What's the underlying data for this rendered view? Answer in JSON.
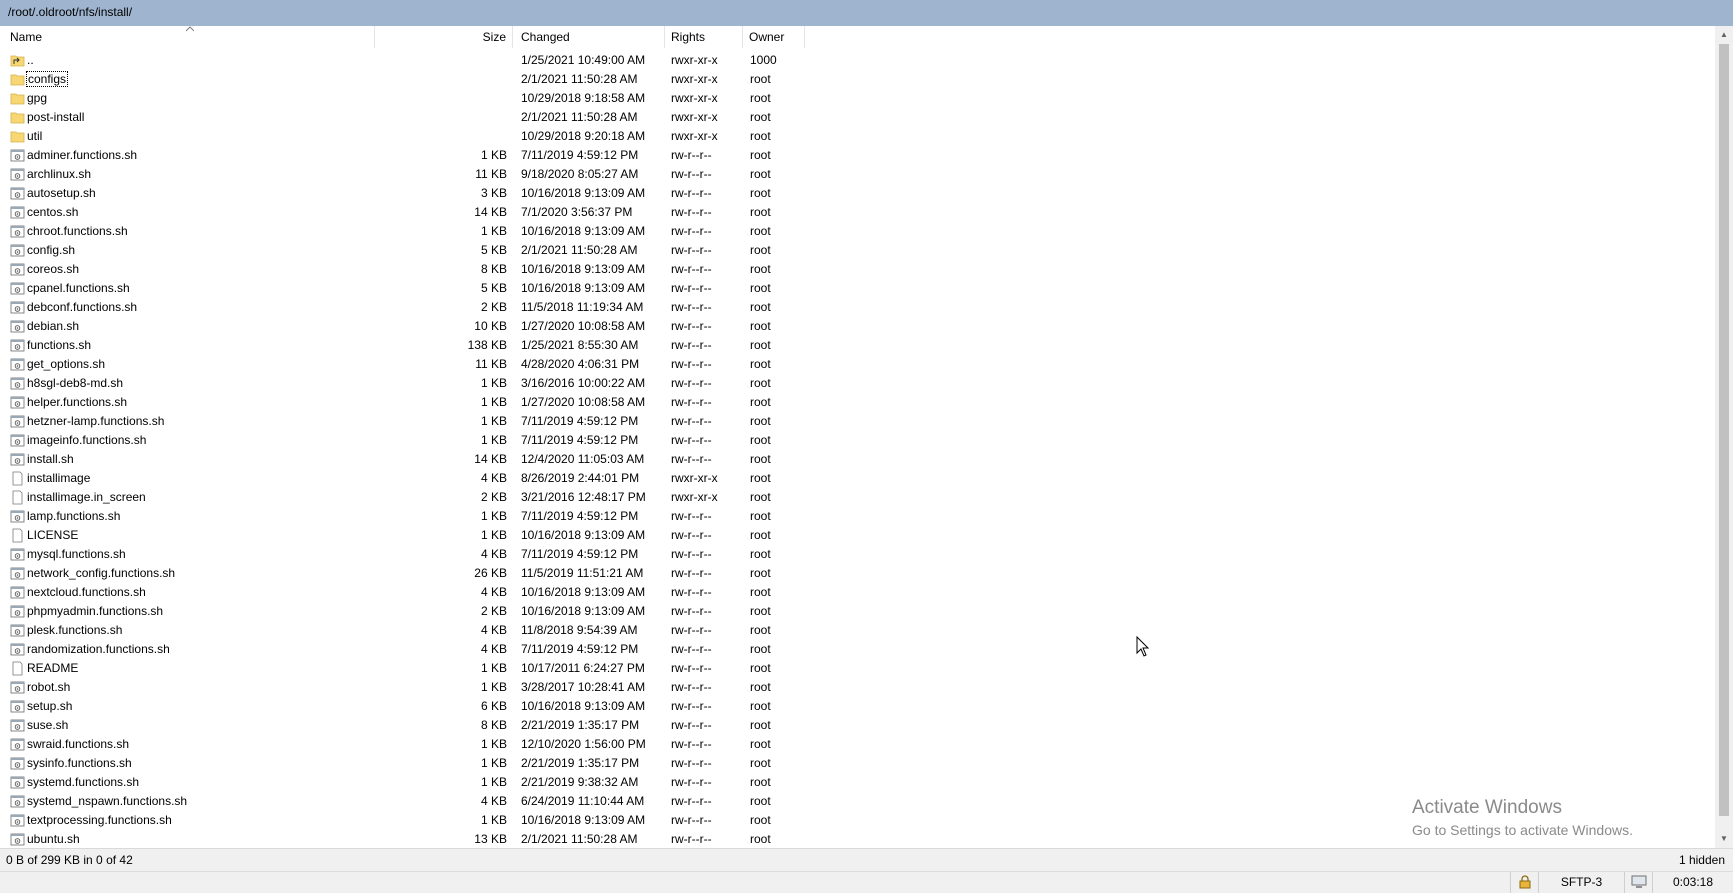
{
  "path": "/root/.oldroot/nfs/install/",
  "columns": {
    "name": "Name",
    "size": "Size",
    "changed": "Changed",
    "rights": "Rights",
    "owner": "Owner"
  },
  "files": [
    {
      "name": "..",
      "size": "",
      "changed": "1/25/2021 10:49:00 AM",
      "rights": "rwxr-xr-x",
      "owner": "1000",
      "icon": "parent-folder-icon"
    },
    {
      "name": "configs",
      "size": "",
      "changed": "2/1/2021 11:50:28 AM",
      "rights": "rwxr-xr-x",
      "owner": "root",
      "icon": "folder-icon"
    },
    {
      "name": "gpg",
      "size": "",
      "changed": "10/29/2018 9:18:58 AM",
      "rights": "rwxr-xr-x",
      "owner": "root",
      "icon": "folder-icon"
    },
    {
      "name": "post-install",
      "size": "",
      "changed": "2/1/2021 11:50:28 AM",
      "rights": "rwxr-xr-x",
      "owner": "root",
      "icon": "folder-icon"
    },
    {
      "name": "util",
      "size": "",
      "changed": "10/29/2018 9:20:18 AM",
      "rights": "rwxr-xr-x",
      "owner": "root",
      "icon": "folder-icon"
    },
    {
      "name": "adminer.functions.sh",
      "size": "1 KB",
      "changed": "7/11/2019 4:59:12 PM",
      "rights": "rw-r--r--",
      "owner": "root",
      "icon": "script-file-icon"
    },
    {
      "name": "archlinux.sh",
      "size": "11 KB",
      "changed": "9/18/2020 8:05:27 AM",
      "rights": "rw-r--r--",
      "owner": "root",
      "icon": "script-file-icon"
    },
    {
      "name": "autosetup.sh",
      "size": "3 KB",
      "changed": "10/16/2018 9:13:09 AM",
      "rights": "rw-r--r--",
      "owner": "root",
      "icon": "script-file-icon"
    },
    {
      "name": "centos.sh",
      "size": "14 KB",
      "changed": "7/1/2020 3:56:37 PM",
      "rights": "rw-r--r--",
      "owner": "root",
      "icon": "script-file-icon"
    },
    {
      "name": "chroot.functions.sh",
      "size": "1 KB",
      "changed": "10/16/2018 9:13:09 AM",
      "rights": "rw-r--r--",
      "owner": "root",
      "icon": "script-file-icon"
    },
    {
      "name": "config.sh",
      "size": "5 KB",
      "changed": "2/1/2021 11:50:28 AM",
      "rights": "rw-r--r--",
      "owner": "root",
      "icon": "script-file-icon"
    },
    {
      "name": "coreos.sh",
      "size": "8 KB",
      "changed": "10/16/2018 9:13:09 AM",
      "rights": "rw-r--r--",
      "owner": "root",
      "icon": "script-file-icon"
    },
    {
      "name": "cpanel.functions.sh",
      "size": "5 KB",
      "changed": "10/16/2018 9:13:09 AM",
      "rights": "rw-r--r--",
      "owner": "root",
      "icon": "script-file-icon"
    },
    {
      "name": "debconf.functions.sh",
      "size": "2 KB",
      "changed": "11/5/2018 11:19:34 AM",
      "rights": "rw-r--r--",
      "owner": "root",
      "icon": "script-file-icon"
    },
    {
      "name": "debian.sh",
      "size": "10 KB",
      "changed": "1/27/2020 10:08:58 AM",
      "rights": "rw-r--r--",
      "owner": "root",
      "icon": "script-file-icon"
    },
    {
      "name": "functions.sh",
      "size": "138 KB",
      "changed": "1/25/2021 8:55:30 AM",
      "rights": "rw-r--r--",
      "owner": "root",
      "icon": "script-file-icon"
    },
    {
      "name": "get_options.sh",
      "size": "11 KB",
      "changed": "4/28/2020 4:06:31 PM",
      "rights": "rw-r--r--",
      "owner": "root",
      "icon": "script-file-icon"
    },
    {
      "name": "h8sgl-deb8-md.sh",
      "size": "1 KB",
      "changed": "3/16/2016 10:00:22 AM",
      "rights": "rw-r--r--",
      "owner": "root",
      "icon": "script-file-icon"
    },
    {
      "name": "helper.functions.sh",
      "size": "1 KB",
      "changed": "1/27/2020 10:08:58 AM",
      "rights": "rw-r--r--",
      "owner": "root",
      "icon": "script-file-icon"
    },
    {
      "name": "hetzner-lamp.functions.sh",
      "size": "1 KB",
      "changed": "7/11/2019 4:59:12 PM",
      "rights": "rw-r--r--",
      "owner": "root",
      "icon": "script-file-icon"
    },
    {
      "name": "imageinfo.functions.sh",
      "size": "1 KB",
      "changed": "7/11/2019 4:59:12 PM",
      "rights": "rw-r--r--",
      "owner": "root",
      "icon": "script-file-icon"
    },
    {
      "name": "install.sh",
      "size": "14 KB",
      "changed": "12/4/2020 11:05:03 AM",
      "rights": "rw-r--r--",
      "owner": "root",
      "icon": "script-file-icon"
    },
    {
      "name": "installimage",
      "size": "4 KB",
      "changed": "8/26/2019 2:44:01 PM",
      "rights": "rwxr-xr-x",
      "owner": "root",
      "icon": "plain-file-icon"
    },
    {
      "name": "installimage.in_screen",
      "size": "2 KB",
      "changed": "3/21/2016 12:48:17 PM",
      "rights": "rwxr-xr-x",
      "owner": "root",
      "icon": "plain-file-icon"
    },
    {
      "name": "lamp.functions.sh",
      "size": "1 KB",
      "changed": "7/11/2019 4:59:12 PM",
      "rights": "rw-r--r--",
      "owner": "root",
      "icon": "script-file-icon"
    },
    {
      "name": "LICENSE",
      "size": "1 KB",
      "changed": "10/16/2018 9:13:09 AM",
      "rights": "rw-r--r--",
      "owner": "root",
      "icon": "plain-file-icon"
    },
    {
      "name": "mysql.functions.sh",
      "size": "4 KB",
      "changed": "7/11/2019 4:59:12 PM",
      "rights": "rw-r--r--",
      "owner": "root",
      "icon": "script-file-icon"
    },
    {
      "name": "network_config.functions.sh",
      "size": "26 KB",
      "changed": "11/5/2019 11:51:21 AM",
      "rights": "rw-r--r--",
      "owner": "root",
      "icon": "script-file-icon"
    },
    {
      "name": "nextcloud.functions.sh",
      "size": "4 KB",
      "changed": "10/16/2018 9:13:09 AM",
      "rights": "rw-r--r--",
      "owner": "root",
      "icon": "script-file-icon"
    },
    {
      "name": "phpmyadmin.functions.sh",
      "size": "2 KB",
      "changed": "10/16/2018 9:13:09 AM",
      "rights": "rw-r--r--",
      "owner": "root",
      "icon": "script-file-icon"
    },
    {
      "name": "plesk.functions.sh",
      "size": "4 KB",
      "changed": "11/8/2018 9:54:39 AM",
      "rights": "rw-r--r--",
      "owner": "root",
      "icon": "script-file-icon"
    },
    {
      "name": "randomization.functions.sh",
      "size": "4 KB",
      "changed": "7/11/2019 4:59:12 PM",
      "rights": "rw-r--r--",
      "owner": "root",
      "icon": "script-file-icon"
    },
    {
      "name": "README",
      "size": "1 KB",
      "changed": "10/17/2011 6:24:27 PM",
      "rights": "rw-r--r--",
      "owner": "root",
      "icon": "plain-file-icon"
    },
    {
      "name": "robot.sh",
      "size": "1 KB",
      "changed": "3/28/2017 10:28:41 AM",
      "rights": "rw-r--r--",
      "owner": "root",
      "icon": "script-file-icon"
    },
    {
      "name": "setup.sh",
      "size": "6 KB",
      "changed": "10/16/2018 9:13:09 AM",
      "rights": "rw-r--r--",
      "owner": "root",
      "icon": "script-file-icon"
    },
    {
      "name": "suse.sh",
      "size": "8 KB",
      "changed": "2/21/2019 1:35:17 PM",
      "rights": "rw-r--r--",
      "owner": "root",
      "icon": "script-file-icon"
    },
    {
      "name": "swraid.functions.sh",
      "size": "1 KB",
      "changed": "12/10/2020 1:56:00 PM",
      "rights": "rw-r--r--",
      "owner": "root",
      "icon": "script-file-icon"
    },
    {
      "name": "sysinfo.functions.sh",
      "size": "1 KB",
      "changed": "2/21/2019 1:35:17 PM",
      "rights": "rw-r--r--",
      "owner": "root",
      "icon": "script-file-icon"
    },
    {
      "name": "systemd.functions.sh",
      "size": "1 KB",
      "changed": "2/21/2019 9:38:32 AM",
      "rights": "rw-r--r--",
      "owner": "root",
      "icon": "script-file-icon"
    },
    {
      "name": "systemd_nspawn.functions.sh",
      "size": "4 KB",
      "changed": "6/24/2019 11:10:44 AM",
      "rights": "rw-r--r--",
      "owner": "root",
      "icon": "script-file-icon"
    },
    {
      "name": "textprocessing.functions.sh",
      "size": "1 KB",
      "changed": "10/16/2018 9:13:09 AM",
      "rights": "rw-r--r--",
      "owner": "root",
      "icon": "script-file-icon"
    },
    {
      "name": "ubuntu.sh",
      "size": "13 KB",
      "changed": "2/1/2021 11:50:28 AM",
      "rights": "rw-r--r--",
      "owner": "root",
      "icon": "script-file-icon"
    }
  ],
  "focused_row": 1,
  "status": {
    "selection": "0 B of 299 KB in 0 of 42",
    "hidden": "1 hidden"
  },
  "bottom": {
    "protocol": "SFTP-3",
    "elapsed": "0:03:18"
  },
  "watermark": {
    "line1": "Activate Windows",
    "line2": "Go to Settings to activate Windows."
  },
  "colors": {
    "path_bar": "#9fb4cf",
    "folder": "#f7d774"
  }
}
